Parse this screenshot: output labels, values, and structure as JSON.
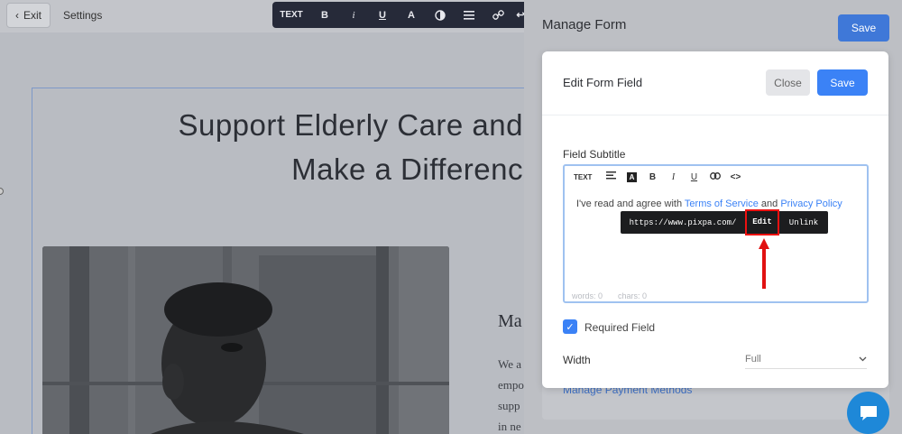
{
  "topbar": {
    "exit_label": "Exit",
    "settings_label": "Settings",
    "toolbar": {
      "text": "TEXT",
      "bold": "B",
      "italic": "i",
      "underline": "U",
      "font_color": "A"
    }
  },
  "canvas": {
    "headline": "Support Elderly Care and\nMake a Differenc",
    "side_heading": "Ma",
    "side_text_lines": [
      "We a",
      "empo",
      "supp",
      "in ne"
    ]
  },
  "manage_form": {
    "title": "Manage Form",
    "save_label": "Save",
    "manage_payment_link": "Manage Payment Methods"
  },
  "edit_field": {
    "title": "Edit Form Field",
    "close_label": "Close",
    "save_label": "Save",
    "field_subtitle_label": "Field Subtitle",
    "editor_toolbar": {
      "text": "TEXT",
      "bold": "B",
      "italic": "I",
      "underline": "U",
      "dark_a": "A",
      "code": "<>"
    },
    "body_prefix": "I've read and agree with ",
    "terms_link": "Terms of Service",
    "body_and": " and ",
    "privacy_link": "Privacy Policy",
    "words_count": "words: 0",
    "chars_count": "chars: 0",
    "link_popup": {
      "url": "https://www.pixpa.com/",
      "edit_label": "Edit",
      "unlink_label": "Unlink"
    },
    "required_label": "Required Field",
    "required_checked": true,
    "width_label": "Width",
    "width_value": "Full"
  },
  "colors": {
    "accent": "#3b82f6",
    "highlight": "#e11111",
    "toolbar_bg": "#262a39"
  }
}
